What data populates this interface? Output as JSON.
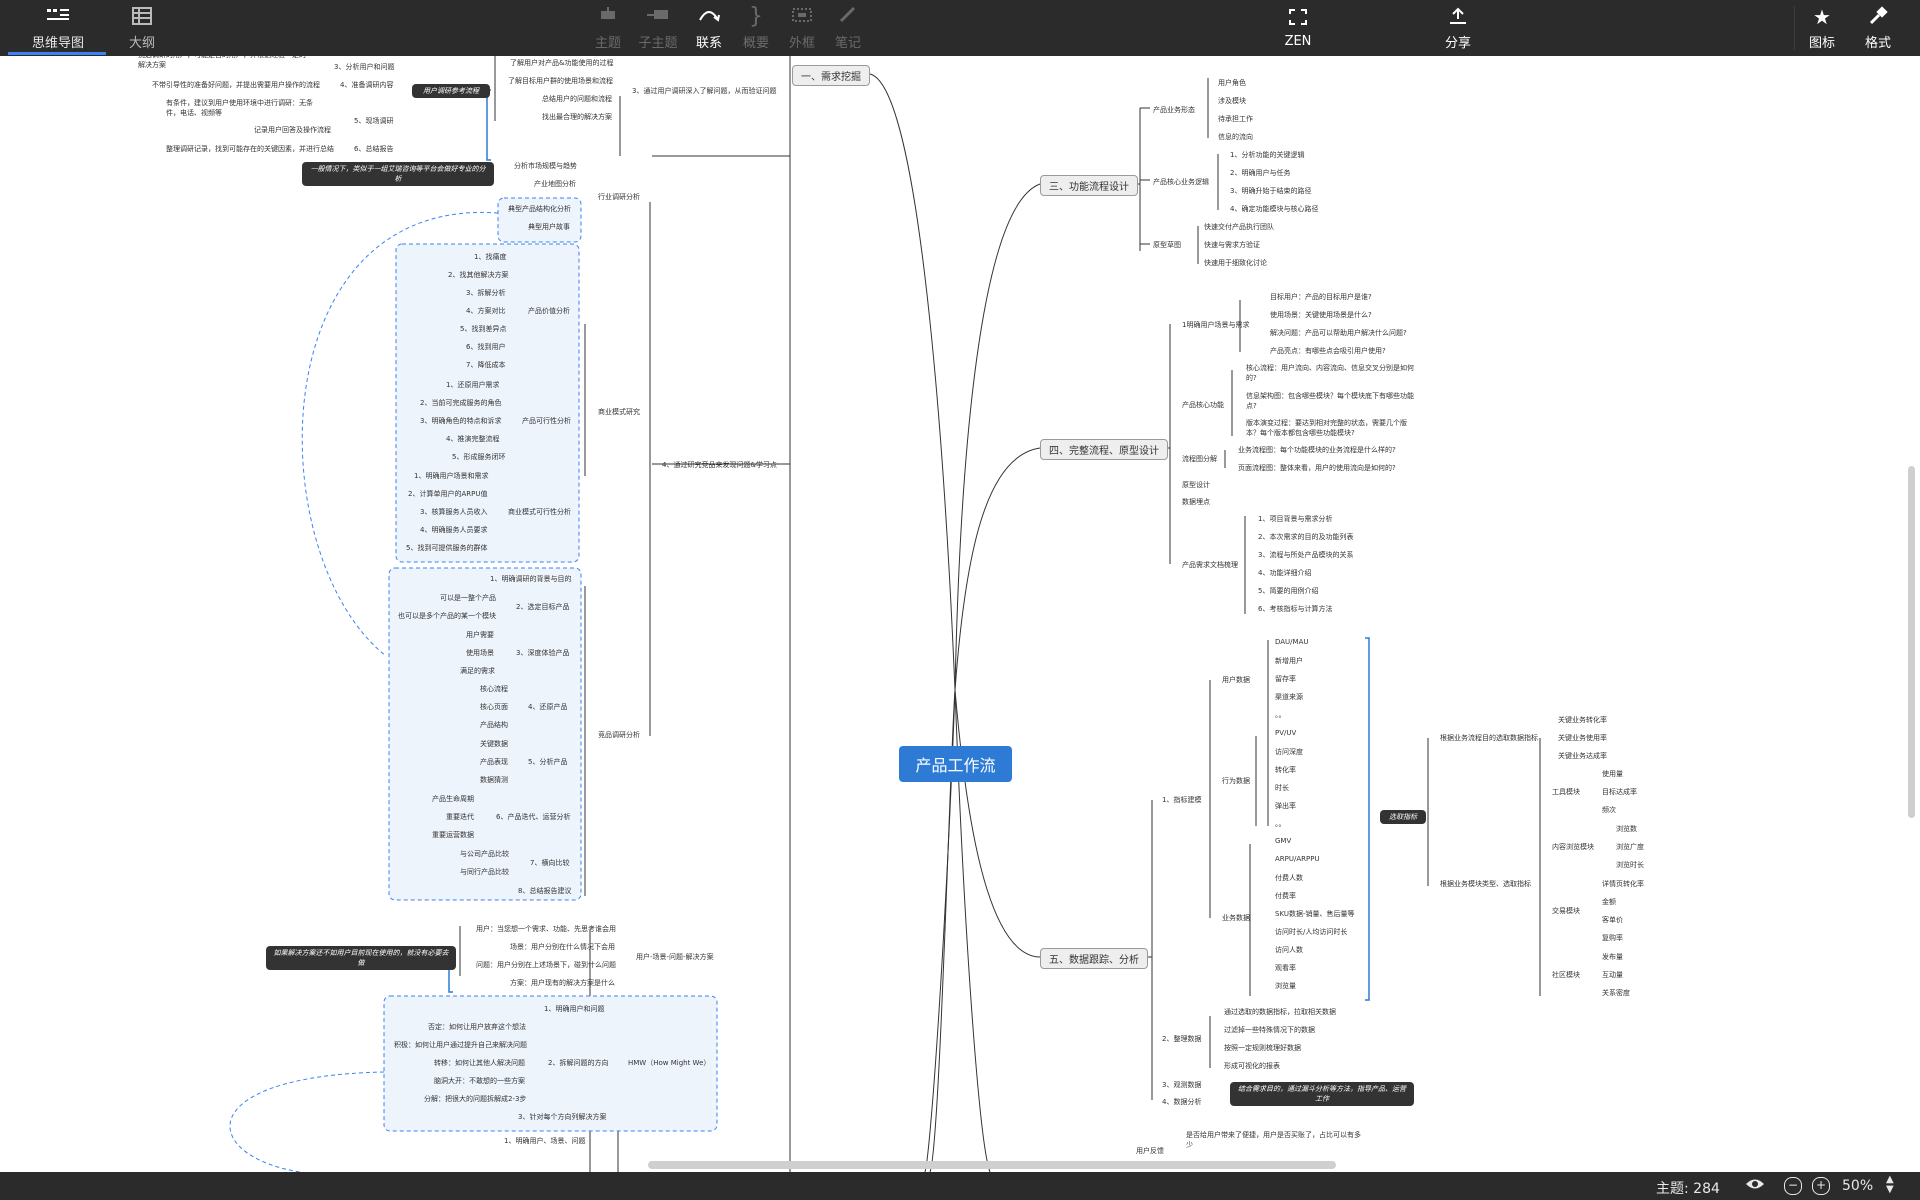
{
  "toolbar": {
    "tab_mindmap": "思维导图",
    "tab_outline": "大纲",
    "topic": "主题",
    "subtopic": "子主题",
    "relation": "联系",
    "summary": "概要",
    "boundary": "外框",
    "note": "笔记",
    "zen": "ZEN",
    "share": "分享",
    "icons": "图标",
    "format": "格式"
  },
  "status": {
    "topic_count": "主题: 284",
    "zoom": "50%"
  },
  "root": "产品工作流",
  "right": {
    "b1": "一、需求挖掘",
    "b3": "三、功能流程设计",
    "b3_c1": "产品业务形态",
    "b3_c1_items": [
      "用户角色",
      "涉及模块",
      "待承担工作",
      "信息的流向"
    ],
    "b3_c2": "产品核心业务逻辑",
    "b3_c2_items": [
      "1、分析功能的关键逻辑",
      "2、明确用户与任务",
      "3、明确升始于结束的路径",
      "4、确定功能模块与核心路径"
    ],
    "b3_c3": "原型草图",
    "b3_c3_items": [
      "快速交付产品执行团队",
      "快速与需求方验证",
      "快速用于细致化讨论"
    ],
    "b4": "四、完整流程、原型设计",
    "b4_c1": "1明确用户场景与需求",
    "b4_c1_items": [
      "目标用户：产品的目标用户是谁?",
      "使用场景：关键使用场景是什么?",
      "解决问题：产品可以帮助用户解决什么问题?",
      "产品亮点：有哪些点会吸引用户使用?"
    ],
    "b4_c2": "产品核心功能",
    "b4_c2_items": [
      "核心流程：用户流向、内容流向、信息交叉分别是如何的?",
      "信息架构图：包含哪些模块？每个模块底下有哪些功能点?",
      "版本演变过程：要达到相对完整的状态，需要几个版本？每个版本都包含哪些功能模块?"
    ],
    "b4_c3": "流程图分解",
    "b4_c3_items": [
      "业务流程图：每个功能模块的业务流程是什么样的?",
      "页面流程图：整体来看，用户的使用流向是如何的?"
    ],
    "b4_c4": "原型设计",
    "b4_c5": "数据埋点",
    "b4_c6": "产品需求文档梳理",
    "b4_c6_items": [
      "1、项目背景与需求分析",
      "2、本次需求的目的及功能列表",
      "3、流程与所处产品模块的关系",
      "4、功能详细介绍",
      "5、简要的用例介绍",
      "6、考核指标与计算方法"
    ],
    "b5": "五、数据跟踪、分析",
    "b5_c1": "1、指标建模",
    "b5_c1_g1": "用户数据",
    "b5_c1_g1_items": [
      "DAU/MAU",
      "新增用户",
      "留存率",
      "渠道来源",
      "。。"
    ],
    "b5_c1_g2": "行为数据",
    "b5_c1_g2_items": [
      "PV/UV",
      "访问深度",
      "转化率",
      "时长",
      "弹出率",
      "。。"
    ],
    "b5_c1_g3": "业务数据",
    "b5_c1_g3_items": [
      "GMV",
      "ARPU/ARPPU",
      "付费人数",
      "付费率",
      "SKU数据-销量、售后量等",
      "访问时长/人均访问时长",
      "访问人数",
      "观看率",
      "浏览量"
    ],
    "b5_select": "选取指标",
    "b5_sel_a": "根据业务流程目的选取数据指标",
    "b5_sel_a_items": [
      "关键业务转化率",
      "关键业务使用率",
      "关键业务达成率"
    ],
    "b5_sel_b": "根据业务模块类型、选取指标",
    "b5_tool": "工具模块",
    "b5_tool_items": [
      "使用量",
      "目标达成率",
      "频次"
    ],
    "b5_content": "内容浏览模块",
    "b5_content_items": [
      "浏览数",
      "浏览广度",
      "浏览时长"
    ],
    "b5_trade": "交易模块",
    "b5_trade_items": [
      "详情页转化率",
      "金额",
      "客单价",
      "复购率"
    ],
    "b5_social": "社区模块",
    "b5_social_items": [
      "发布量",
      "互动量",
      "关系密度"
    ],
    "b5_c2": "2、整理数据",
    "b5_c2_items": [
      "通过选取的数据指标，拉取相关数据",
      "过滤掉一些特殊情况下的数据",
      "按照一定规则梳理好数据",
      "形成可视化的报表"
    ],
    "b5_c3": "3、观测数据",
    "b5_c4": "4、数据分析",
    "b5_c4_note": "结合需求目的，通过漏斗分析等方法，指导产品、运营工作",
    "b6_partial": "用户反馈",
    "b6_partial_item": "是否给用户带来了便捷，用户是否买账了，占比可以有多少"
  },
  "left": {
    "top_items": [
      "3、分析用户和问题",
      "4、准备调研内容",
      "5、现场调研",
      "6、总结报告"
    ],
    "top_notes": [
      "挑选调研的用户，可能是目的用户，并根据经验一定的解决方案",
      "不带引导性的准备好问题，并提出需要用户操作的流程",
      "有条件，建议到用户使用环境中进行调研：无条件，电话、视频等",
      "记录用户回答及操作流程",
      "整理调研记录，找到可能存在的关键因素，并进行总结"
    ],
    "ref_flow": "用户调研参考流程",
    "sec3_items": [
      "了解用户对产品&功能使用的过程",
      "了解目标用户群的使用场景和流程",
      "总结用户的问题和流程",
      "找出最合理的解决方案"
    ],
    "sec3": "3、通过用户调研深入了解问题，从而验证问题",
    "industry_note": "一般情况下，类似于一组艾瑞咨询等平台会做好专业的分析",
    "industry": "行业调研分析",
    "industry_items": [
      "分析市场规模与趋势",
      "产业地图分析",
      "典型产品结构化分析",
      "典型用户故事"
    ],
    "business": "商业模式研究",
    "value": "产品价值分析",
    "value_items": [
      "1、找痛度",
      "2、找其他解决方案",
      "3、拆解分析",
      "4、方案对比",
      "5、找到差异点",
      "6、找到用户",
      "7、降低成本"
    ],
    "feasible": "产品可行性分析",
    "feasible_items": [
      "1、还原用户需求",
      "2、当前可完成服务的角色",
      "3、明确角色的特点和诉求",
      "4、推演完整流程",
      "5、形成服务闭环"
    ],
    "biz_feasible": "商业模式可行性分析",
    "biz_feasible_items": [
      "1、明确用户场景和需求",
      "2、计算单用户的ARPU值",
      "3、核算服务人员收入",
      "4、明确服务人员要求",
      "5、找到可提供服务的群体"
    ],
    "sec4": "4、通过研究竞品来发现问题&学习点",
    "compete": "竞品调研分析",
    "c1": "1、明确调研的背景与目的",
    "c2": "2、选定目标产品",
    "c2_items": [
      "可以是一整个产品",
      "也可以是多个产品的某一个模块"
    ],
    "c3": "3、深度体验产品",
    "c3_items": [
      "用户需要",
      "使用场景",
      "满足的需求"
    ],
    "c4": "4、还原产品",
    "c4_items": [
      "核心流程",
      "核心页面",
      "产品结构"
    ],
    "c5": "5、分析产品",
    "c5_items": [
      "关键数据",
      "产品表现",
      "数据猜测"
    ],
    "c6": "6、产品迭代、运营分析",
    "c6_items": [
      "产品生命周期",
      "重要迭代",
      "重要运营数据"
    ],
    "c7": "7、横向比较",
    "c7_items": [
      "与公司产品比较",
      "与同行产品比较"
    ],
    "c8": "8、总结报告建议",
    "psu_note": "如果解决方案还不如用户目前现在使用的，就没有必要去做",
    "psu": "用户-场景-问题-解决方案",
    "psu_items": [
      "用户：当您想一个需求、功能、先思考谁会用",
      "场景：用户分别在什么情况下会用",
      "问题：用户分别在上述场景下，碰到什么问题",
      "方案：用户现有的解决方案是什么"
    ],
    "hmw": "HMW（How Might We）",
    "hmw1": "1、明确用户和问题",
    "hmw2": "2、拆解问题的方向",
    "hmw2_items": [
      "否定：如何让用户放弃这个想法",
      "积极：如何让用户通过提升自己来解决问题",
      "转移：如何让其他人解决问题",
      "脑洞大开：不敢想的一些方案",
      "分解：把很大的问题拆解成2-3步"
    ],
    "hmw3": "3、针对每个方向列解决方案",
    "bottom_partial": "1、明确用户、场景、问题"
  },
  "colors": {
    "toolbar_bg": "#2b2b2b",
    "root_bg": "#2e7bd6",
    "dashed_boundary": "#3b82f6",
    "accent": "#3b82f6"
  }
}
